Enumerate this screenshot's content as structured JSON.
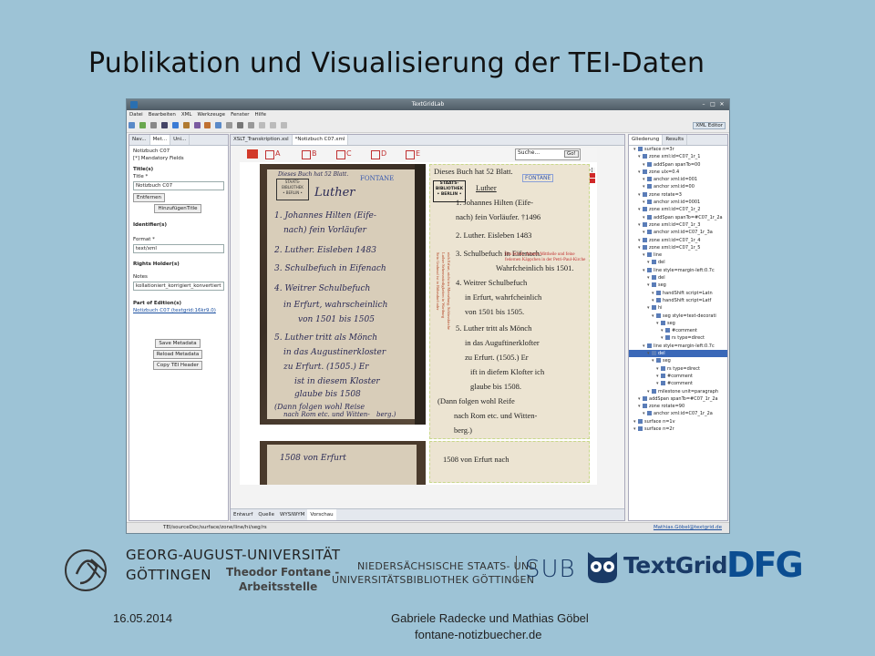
{
  "slide": {
    "title": "Publikation und Visualisierung der TEI-Daten",
    "date": "16.05.2014",
    "authors": "Gabriele Radecke und Mathias Göbel",
    "url": "fontane-notizbuecher.de"
  },
  "window": {
    "title": "TextGridLab",
    "menu": [
      "Datei",
      "Bearbeiten",
      "XML",
      "Werkzeuge",
      "Fenster",
      "Hilfe"
    ],
    "perspective": "XML Editor"
  },
  "left_panel": {
    "tabs": [
      "Nav...",
      "Met...",
      "Uni..."
    ],
    "object": "Notizbuch C07",
    "mandatory": "[*] Mandatory Fields",
    "title_section": "Title(s)",
    "title_label": "Title *",
    "title_value": "Notizbuch C07",
    "remove_btn": "Entfernen",
    "add_btn": "HinzufügenTitle",
    "identifier_section": "Identifier(s)",
    "format_label": "Format *",
    "format_value": "text/xml",
    "rights_section": "Rights Holder(s)",
    "notes_label": "Notes",
    "notes_value": "kollationiert_korrigiert_konvertiert",
    "part_section": "Part of Edition(s)",
    "part_link": "Notizbuch C07 (textgrid:16kr9.0)",
    "save_btn": "Save Metadata",
    "reload_btn": "Reload Metadata",
    "copy_btn": "Copy TEI Header"
  },
  "editor": {
    "tabs": [
      "XSLT_Transkription.xsl",
      "*Notizbuch C07.xml"
    ],
    "letters": [
      "A",
      "B",
      "C",
      "D",
      "E"
    ],
    "search_label": "Suche...",
    "go_btn": "Go!",
    "inhalt": "Inhalt [-/+]",
    "stamp": [
      "STAATS-",
      "BIBLIOTHEK",
      "• BERLIN •"
    ],
    "fontane_stamp": "FONTANE",
    "transcription": [
      "Dieses Buch hat 52 Blatt.",
      "Luther",
      "1. Johannes Hilten (Eife-",
      "nach) fein Vorläufer. †1496",
      "2. Luther. Eisleben 1483",
      "3. Schulbefuch in Eifenach.",
      "Wahrfcheinlich bis 1501.",
      "4. Weitrer Schulbefuch",
      "in Erfurt, wahrfcheinlich",
      "von 1501 bis 1505.",
      "5. Luther tritt als Mönch",
      "in das Auguftinerklofter",
      "zu Erfurt. (1505.) Er",
      "ift in diefem Klofter ich",
      "glaube bis 1508.",
      "(Dann folgen wohl Reife",
      "nach Rom etc. und Witten-",
      "berg.)"
    ],
    "red_note": [
      "Ein Schuh, feinem Mittheile und feine",
      "federnen Käppchen in der Petri-Paul-Kirche"
    ],
    "vertical_notes": [
      "Sein Grabmal ist in Röhrsdorf oder",
      "Luther Sehenswürdigkeiten in Wartburg",
      "nich Erfurt, nicht ins Merseburg. Schlosskirche"
    ],
    "handwriting": [
      "Dieses Buch hat 52 Blatt.",
      "Luther",
      "1. Johannes Hilten (Eife-",
      "nach) fein Vorläufer",
      "2. Luther. Eisleben 1483",
      "3. Schulbefuch in Eifenach",
      "4. Weitrer Schulbefuch",
      "in Erfurt, wahrscheinlich",
      "von 1501 bis 1505",
      "5. Luther tritt als Mönch",
      "in das Augustinerkloster",
      "zu Erfurt. (1505.) Er",
      "ist in diesem Kloster",
      "glaube bis 1508",
      "(Dann folgen wohl Reise",
      "nach Rom etc. und Witten-",
      "berg.)"
    ],
    "page2_text": "1508 von Erfurt nach",
    "page2_hw": "1508 von Erfurt",
    "bottom_tabs": [
      "Entwurf",
      "Quelle",
      "WYSIWYM",
      "Vorschau"
    ]
  },
  "right_panel": {
    "tabs": [
      "Gliederung",
      "Results"
    ],
    "tree": [
      "surface n=3r",
      "zone xml:id=C07_1r_1",
      "addSpan spanTo=00",
      "zone ulx=0.4",
      "anchor xml:id=001",
      "anchor xml:id=00",
      "zone rotate=3",
      "anchor xml:id=0001",
      "zone xml:id=C07_1r_2",
      "addSpan spanTo=#C07_1r_2a",
      "zone xml:id=C07_1r_3",
      "anchor xml:id=C07_1r_3a",
      "zone xml:id=C07_1r_4",
      "zone xml:id=C07_1r_5",
      "line",
      "del",
      "line style=margin-left:0.7c",
      "del",
      "seg",
      "handShift script=Latn",
      "handShift script=Latf",
      "hi",
      "seg style=text-decorati",
      "seg",
      "#comment",
      "rs type=direct",
      "line style=margin-left:0.7c",
      "del",
      "seg",
      "rs type=direct",
      "#comment",
      "#comment",
      "milestone unit=paragraph",
      "addSpan spanTo=#C07_1r_2a",
      "zone rotate=90",
      "anchor xml:id=C07_1r_2a",
      "surface n=1v",
      "surface n=2r"
    ],
    "selected_index": 27
  },
  "status": {
    "path": "TEI/sourceDoc/surface/zone/line/hi/seg/rs",
    "user": "Mathias.Göbel@textgrid.de"
  },
  "logos": {
    "goe_line1": "GEORG-AUGUST-UNIVERSITÄT",
    "goe_line2": "GÖTTINGEN",
    "fontane_line1": "Theodor Fontane -",
    "fontane_line2": "Arbeitsstelle",
    "nsub_line1": "NIEDERSÄCHSISCHE STAATS- UND",
    "nsub_line2": "UNIVERSITÄTSBIBLIOTHEK GÖTTINGEN",
    "sub": "SUB",
    "textgrid": "TextGrid",
    "dfg": "DFG"
  },
  "colors": {
    "slide_bg": "#9dc3d6",
    "textgrid_blue": "#1a3a66",
    "dfg_blue": "#0b4d91",
    "letter_red": "#c03030"
  }
}
